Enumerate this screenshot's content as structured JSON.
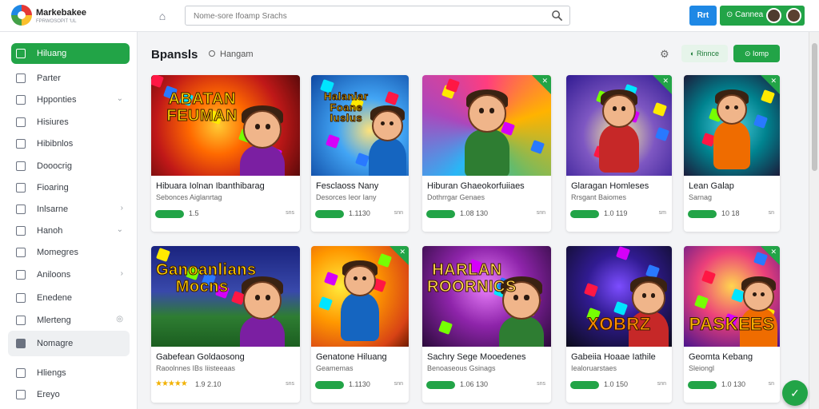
{
  "app": {
    "brand": "Markebakee",
    "brand_sub": "FPRWOSOPIT 'UL"
  },
  "search": {
    "placeholder": "Nome-sore Ifoamp Srachs"
  },
  "topbar": {
    "btn_primary": "Rrt",
    "btn_account": "Cannea"
  },
  "sidebar": {
    "items": [
      {
        "label": "Hiluang",
        "icon": "grid-icon",
        "active": true
      },
      {
        "label": "Parter",
        "icon": "square-icon"
      },
      {
        "label": "Hpponties",
        "icon": "square-icon",
        "chevron": "⌄"
      },
      {
        "label": "Hisiures",
        "icon": "square-icon"
      },
      {
        "label": "Hibibnlos",
        "icon": "square-icon"
      },
      {
        "label": "Dooocrig",
        "icon": "square-icon"
      },
      {
        "label": "Fioaring",
        "icon": "square-icon"
      },
      {
        "label": "Inlsarne",
        "icon": "square-icon",
        "chevron": "›"
      },
      {
        "label": "Hanoh",
        "icon": "square-icon",
        "chevron": "⌄"
      },
      {
        "label": "Momegres",
        "icon": "square-icon"
      },
      {
        "label": "Aniloons",
        "icon": "square-icon",
        "chevron": "›"
      },
      {
        "label": "Enedene",
        "icon": "square-icon"
      },
      {
        "label": "Mlerteng",
        "icon": "square-icon",
        "chevron": "◎"
      },
      {
        "label": "Nomagre",
        "icon": "square-icon",
        "highlight": true
      },
      {
        "label": "Hliengs",
        "icon": "square-icon"
      },
      {
        "label": "Ereyo",
        "icon": "square-icon"
      }
    ]
  },
  "main": {
    "title": "Bpansls",
    "subtitle": "Hangam",
    "pill_light": "Rinnce",
    "pill_dark": "Iomp"
  },
  "cards": [
    {
      "name": "Hibuara Iolnan Ibanthibarag",
      "meta": "Sebonces Aiglanrtag",
      "rating": "1.5",
      "rating_style": "badge-star",
      "more": "sns",
      "logo": "ABATAN FEUMAN",
      "theme": "red",
      "corner": false
    },
    {
      "name": "Fesclaoss Nany",
      "meta": "Desorces Ieor Iany",
      "rating": "1.1130",
      "rating_style": "badge",
      "more": "snn",
      "logo": "Halaniar Foane Iuslus",
      "theme": "blue",
      "corner": false
    },
    {
      "name": "Hiburan Ghaeokorfuiiaes",
      "meta": "Dothrrgar Genaes",
      "rating": "1.08 130",
      "rating_style": "badge",
      "more": "snn",
      "logo": "",
      "theme": "rainbow",
      "corner": true
    },
    {
      "name": "Glaragan Homleses",
      "meta": "Rrsgant Baiomes",
      "rating": "1.0 119",
      "rating_style": "badge",
      "more": "sm",
      "logo": "",
      "theme": "purple",
      "corner": true
    },
    {
      "name": "Lean Galap",
      "meta": "Sarnag",
      "rating": "10 18",
      "rating_style": "badge",
      "more": "sn",
      "logo": "",
      "theme": "teal",
      "corner": true
    },
    {
      "name": "Gabefean Goldaosong",
      "meta": "Raoolnnes IBs Iiisteeaas",
      "rating": "1.9 2.10",
      "rating_style": "stars",
      "more": "sns",
      "logo": "Ganoanlians Mocns",
      "theme": "stadium",
      "corner": false
    },
    {
      "name": "Genatone Hiluang",
      "meta": "Geamemas",
      "rating": "1.1130",
      "rating_style": "badge",
      "more": "snn",
      "logo": "",
      "theme": "orange",
      "corner": true
    },
    {
      "name": "Sachry Sege Mooedenes",
      "meta": "Benoaseous Gsinags",
      "rating": "1.06 130",
      "rating_style": "badge",
      "more": "sns",
      "logo": "HARLAN ROORNICS",
      "theme": "magenta",
      "corner": false
    },
    {
      "name": "Gabeiia Hoaae Iathile",
      "meta": "Iealoruarstaes",
      "rating": "1.0 150",
      "rating_style": "badge",
      "more": "snn",
      "logo": "XOBRZ",
      "theme": "dark",
      "corner": false
    },
    {
      "name": "Geomta Kebang",
      "meta": "Sleiongl",
      "rating": "1.0 130",
      "rating_style": "badge",
      "more": "sn",
      "logo": "PASKEES",
      "theme": "gold",
      "corner": true
    }
  ],
  "colors": {
    "accent": "#22a447",
    "primary": "#1e88e5"
  }
}
